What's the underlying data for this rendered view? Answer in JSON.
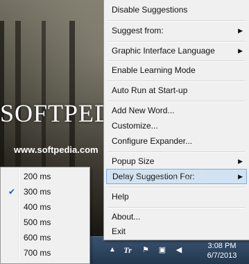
{
  "desktop": {
    "logo_text": "SOFTPEDIA",
    "url_text": "www.softpedia.com",
    "watermark": "SOFTPEDIA"
  },
  "menu": {
    "items": [
      {
        "label": "Disable Suggestions",
        "submenu": false
      },
      {
        "label": "Suggest from:",
        "submenu": true
      },
      {
        "label": "Graphic Interface Language",
        "submenu": true
      },
      {
        "label": "Enable Learning Mode",
        "submenu": false
      },
      {
        "label": "Auto Run at Start-up",
        "submenu": false
      },
      {
        "label": "Add New Word...",
        "submenu": false
      },
      {
        "label": "Customize...",
        "submenu": false
      },
      {
        "label": "Configure Expander...",
        "submenu": false
      },
      {
        "label": "Popup Size",
        "submenu": true
      },
      {
        "label": "Delay Suggestion For:",
        "submenu": true,
        "highlighted": true
      },
      {
        "label": "Help",
        "submenu": false
      },
      {
        "label": "About...",
        "submenu": false
      },
      {
        "label": "Exit",
        "submenu": false
      }
    ],
    "arrow_glyph": "▶"
  },
  "submenu": {
    "items": [
      {
        "label": "200 ms",
        "checked": false
      },
      {
        "label": "300 ms",
        "checked": true
      },
      {
        "label": "400 ms",
        "checked": false
      },
      {
        "label": "500 ms",
        "checked": false
      },
      {
        "label": "600 ms",
        "checked": false
      },
      {
        "label": "700 ms",
        "checked": false
      }
    ],
    "check_glyph": "✔"
  },
  "taskbar": {
    "time": "3:08 PM",
    "date": "6/7/2013",
    "chevron_glyph": "▲",
    "app_icon_text": "Tr",
    "flag_glyph": "⚑",
    "net_glyph": "▣",
    "volume_glyph": "◀"
  },
  "colors": {
    "menu_bg": "#f0f0f0",
    "highlight_bg": "#d1e2f2",
    "highlight_border": "#78aee5",
    "taskbar": "#2c4360"
  }
}
